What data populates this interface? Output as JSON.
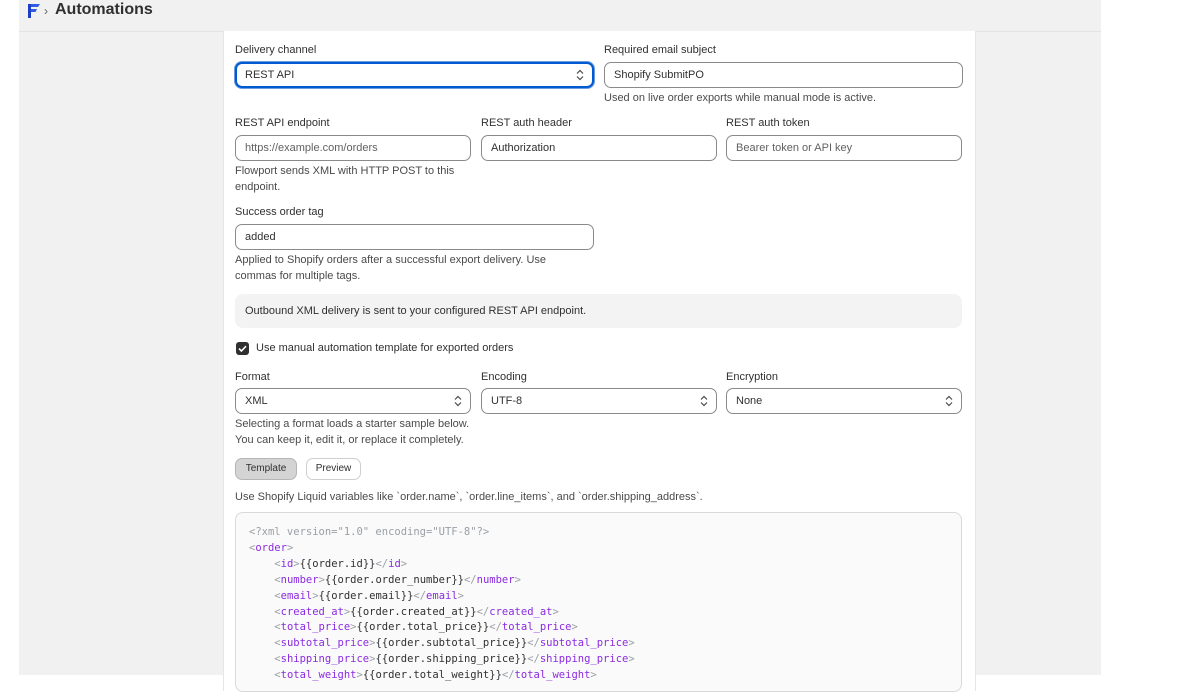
{
  "header": {
    "title": "Automations",
    "separator": "›"
  },
  "delivery_channel": {
    "label": "Delivery channel",
    "value": "REST API"
  },
  "email_subject": {
    "label": "Required email subject",
    "value": "Shopify SubmitPO",
    "help": "Used on live order exports while manual mode is active."
  },
  "rest_endpoint": {
    "label": "REST API endpoint",
    "placeholder": "https://example.com/orders",
    "help_line1": "Flowport sends XML with HTTP POST to this",
    "help_line2": "endpoint."
  },
  "rest_auth_header": {
    "label": "REST auth header",
    "value": "Authorization"
  },
  "rest_auth_token": {
    "label": "REST auth token",
    "placeholder": "Bearer token or API key"
  },
  "success_tag": {
    "label": "Success order tag",
    "value": "added",
    "help_line1": "Applied to Shopify orders after a successful export delivery. Use",
    "help_line2": "commas for multiple tags."
  },
  "banner": {
    "text": "Outbound XML delivery is sent to your configured REST API endpoint."
  },
  "manual_template": {
    "label": "Use manual automation template for exported orders",
    "checked": true
  },
  "format": {
    "label": "Format",
    "value": "XML",
    "help_line1": "Selecting a format loads a starter sample below.",
    "help_line2": "You can keep it, edit it, or replace it completely."
  },
  "encoding": {
    "label": "Encoding",
    "value": "UTF-8"
  },
  "encryption": {
    "label": "Encryption",
    "value": "None"
  },
  "tabs": {
    "template": "Template",
    "preview": "Preview"
  },
  "liquid_help": "Use Shopify Liquid variables like `order.name`, `order.line_items`, and `order.shipping_address`.",
  "code": {
    "declaration": "<?xml version=\"1.0\" encoding=\"UTF-8\"?>",
    "root_tag": "order",
    "fields": [
      {
        "tag": "id",
        "expr": "{{order.id}}"
      },
      {
        "tag": "number",
        "expr": "{{order.order_number}}"
      },
      {
        "tag": "email",
        "expr": "{{order.email}}"
      },
      {
        "tag": "created_at",
        "expr": "{{order.created_at}}"
      },
      {
        "tag": "total_price",
        "expr": "{{order.total_price}}"
      },
      {
        "tag": "subtotal_price",
        "expr": "{{order.subtotal_price}}"
      },
      {
        "tag": "shipping_price",
        "expr": "{{order.shipping_price}}"
      },
      {
        "tag": "total_weight",
        "expr": "{{order.total_weight}}"
      }
    ]
  },
  "colors": {
    "accent": "#005bd3",
    "checkbox": "#303030",
    "code_tag": "#8a2be2"
  }
}
